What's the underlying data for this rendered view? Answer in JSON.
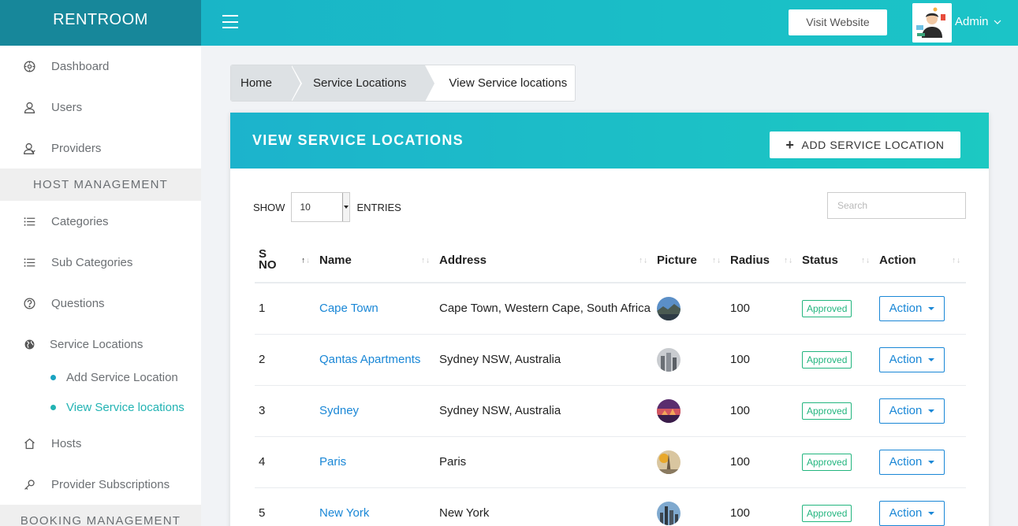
{
  "app": {
    "brand": "RENTROOM"
  },
  "topbar": {
    "visit_label": "Visit Website",
    "user_label": "Admin"
  },
  "sidebar": {
    "items": [
      {
        "label": "Dashboard",
        "icon": "dashboard-icon"
      },
      {
        "label": "Users",
        "icon": "user-icon"
      },
      {
        "label": "Providers",
        "icon": "provider-icon"
      }
    ],
    "host_section": "HOST MANAGEMENT",
    "host_items": [
      {
        "label": "Categories",
        "icon": "list-icon"
      },
      {
        "label": "Sub Categories",
        "icon": "list-icon"
      },
      {
        "label": "Questions",
        "icon": "question-icon"
      },
      {
        "label": "Service Locations",
        "icon": "globe-icon"
      }
    ],
    "service_sub": [
      {
        "label": "Add Service Location",
        "active": false
      },
      {
        "label": "View Service locations",
        "active": true
      }
    ],
    "more_items": [
      {
        "label": "Hosts",
        "icon": "home-icon"
      },
      {
        "label": "Provider Subscriptions",
        "icon": "key-icon"
      }
    ],
    "booking_section": "BOOKING MANAGEMENT"
  },
  "breadcrumb": [
    "Home",
    "Service Locations",
    "View Service locations"
  ],
  "card": {
    "title": "VIEW SERVICE LOCATIONS",
    "add_label": "ADD SERVICE LOCATION",
    "show_label": "SHOW",
    "entries_label": "ENTRIES",
    "page_size": "10",
    "search_placeholder": "Search"
  },
  "table": {
    "headers": [
      "S NO",
      "Name",
      "Address",
      "Picture",
      "Radius",
      "Status",
      "Action"
    ],
    "rows": [
      {
        "sno": "1",
        "name": "Cape Town",
        "address": "Cape Town, Western Cape, South Africa",
        "radius": "100",
        "status": "Approved",
        "action": "Action"
      },
      {
        "sno": "2",
        "name": "Qantas Apartments",
        "address": "Sydney NSW, Australia",
        "radius": "100",
        "status": "Approved",
        "action": "Action"
      },
      {
        "sno": "3",
        "name": "Sydney",
        "address": "Sydney NSW, Australia",
        "radius": "100",
        "status": "Approved",
        "action": "Action"
      },
      {
        "sno": "4",
        "name": "Paris",
        "address": "Paris",
        "radius": "100",
        "status": "Approved",
        "action": "Action"
      },
      {
        "sno": "5",
        "name": "New York",
        "address": "New York",
        "radius": "100",
        "status": "Approved",
        "action": "Action"
      }
    ]
  },
  "colors": {
    "brand": "#17879a",
    "accent": "#1bc4c7",
    "link": "#1a87d6",
    "approved": "#22b57e",
    "active_sub": "#22b3b3"
  }
}
